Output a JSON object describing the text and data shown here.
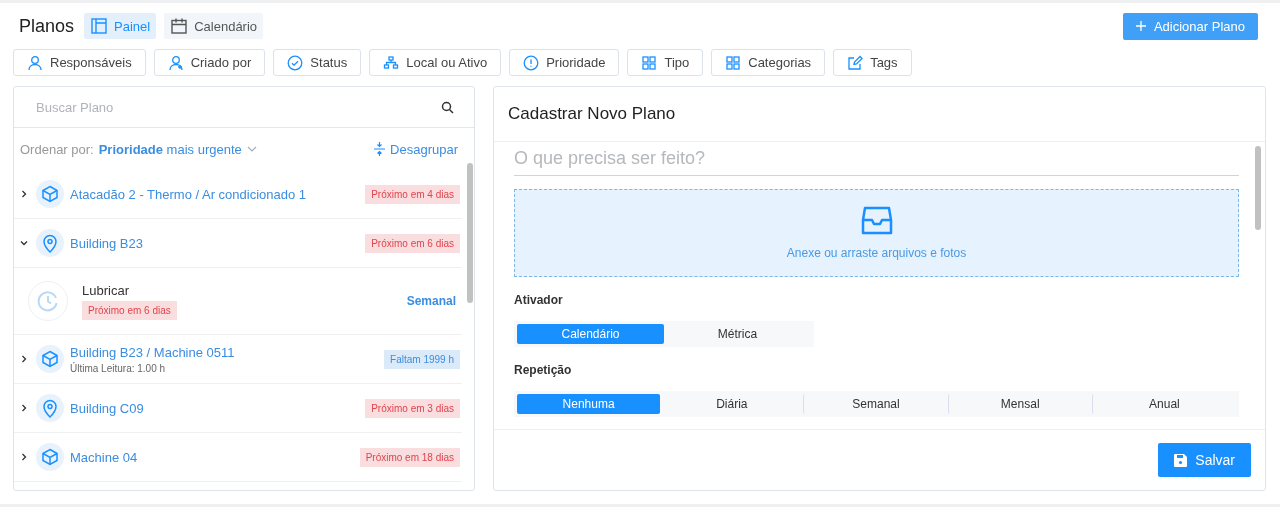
{
  "header": {
    "title": "Planos",
    "views": [
      {
        "label": "Painel",
        "selected": true
      },
      {
        "label": "Calendário",
        "selected": false
      }
    ],
    "add_button": "Adicionar Plano"
  },
  "filters": [
    "Responsáveis",
    "Criado por",
    "Status",
    "Local ou Ativo",
    "Prioridade",
    "Tipo",
    "Categorias",
    "Tags"
  ],
  "list": {
    "search": {
      "placeholder": "Buscar Plano"
    },
    "sort_label": "Ordenar por:",
    "sort_field": "Prioridade",
    "sort_order": "mais urgente",
    "ungroup": "Desagrupar",
    "rows": [
      {
        "kind": "asset",
        "expanded": false,
        "title": "Atacadão 2 - Thermo / Ar condicionado 1",
        "badge": "Próximo em 4 dias",
        "color": "#e0454b"
      },
      {
        "kind": "location",
        "expanded": true,
        "title": "Building B23",
        "badge": "Próximo em 6 dias",
        "color": "#e0454b"
      },
      {
        "kind": "plan",
        "title": "Lubricar",
        "badge": "Próximo em 6 dias",
        "color": "#e0454b",
        "frequency": "Semanal"
      },
      {
        "kind": "asset",
        "expanded": false,
        "title": "Building B23 / Machine 0511",
        "subtitle": "Última Leitura: 1.00 h",
        "badge": "Faltam 1999 h",
        "color": "#3a8de0"
      },
      {
        "kind": "location",
        "expanded": false,
        "title": "Building C09",
        "badge": "Próximo em 3 dias",
        "color": "#e0454b"
      },
      {
        "kind": "asset",
        "expanded": false,
        "title": "Machine 04",
        "badge": "Próximo em 18 dias",
        "color": "#e0454b"
      }
    ]
  },
  "form": {
    "title": "Cadastrar Novo Plano",
    "task": {
      "placeholder": "O que precisa ser feito?"
    },
    "upload": "Anexe ou arraste arquivos e fotos",
    "trigger": {
      "label": "Ativador",
      "options": [
        {
          "label": "Calendário",
          "selected": true
        },
        {
          "label": "Métrica",
          "selected": false
        }
      ]
    },
    "repeat": {
      "label": "Repetição",
      "options": [
        {
          "label": "Nenhuma",
          "selected": true
        },
        {
          "label": "Diária",
          "selected": false
        },
        {
          "label": "Semanal",
          "selected": false
        },
        {
          "label": "Mensal",
          "selected": false
        },
        {
          "label": "Anual",
          "selected": false
        }
      ]
    },
    "save": "Salvar"
  }
}
